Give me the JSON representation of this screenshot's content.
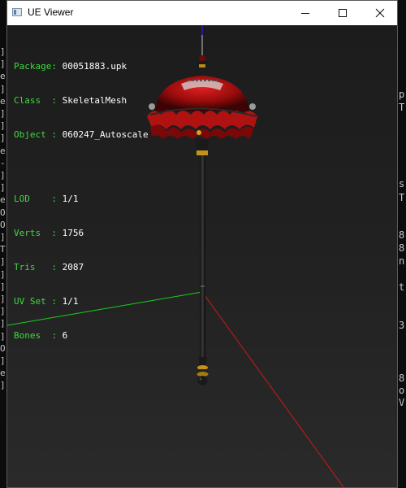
{
  "window": {
    "title": "UE Viewer"
  },
  "controls": {
    "minimize": "—",
    "maximize": "☐",
    "close": "✕"
  },
  "info": {
    "package_label": "Package: ",
    "package": "00051883.upk",
    "class_label": "Class  : ",
    "class": "SkeletalMesh",
    "object_label": "Object : ",
    "object": "060247_Autoscale",
    "lod_label": "LOD    : ",
    "lod": "1/1",
    "verts_label": "Verts  : ",
    "verts": "1756",
    "tris_label": "Tris   : ",
    "tris": "2087",
    "uvset_label": "UV Set : ",
    "uvset": "1/1",
    "bones_label": "Bones  : ",
    "bones": "6"
  },
  "background_console": {
    "left": "]\n]\ne\n]\ne\n]\n]\n]\ne\n-\n]\n]\ne\nO\nO\n]\nT\n]\n]\n]\n]\n]\n]\n]\nO\n]\ne\n]",
    "right": [
      "p",
      "T",
      "s",
      "T",
      "8",
      "8",
      "n",
      "t",
      "3",
      "8",
      "o",
      "V"
    ]
  },
  "colors": {
    "axis_x": "#d01818",
    "axis_y": "#18d018",
    "axis_z": "#2020e0",
    "label": "#3fd93f",
    "value": "#ffffff"
  }
}
